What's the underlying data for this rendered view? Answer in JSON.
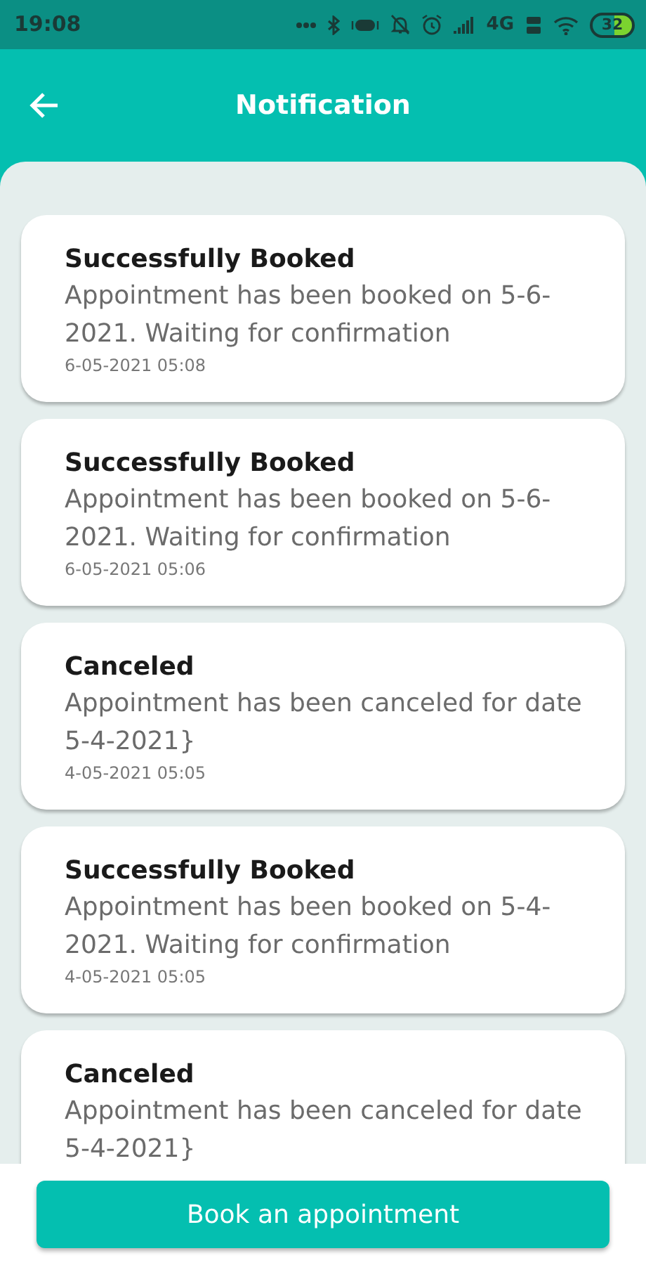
{
  "status_bar": {
    "time": "19:08",
    "network": "4G",
    "battery": "32"
  },
  "header": {
    "title": "Notification"
  },
  "notifications": [
    {
      "title": "Successfully Booked",
      "message": "Appointment has been booked on 5-6-2021. Waiting for confirmation",
      "time": "6-05-2021 05:08"
    },
    {
      "title": "Successfully Booked",
      "message": "Appointment has been booked on 5-6-2021. Waiting for confirmation",
      "time": "6-05-2021 05:06"
    },
    {
      "title": "Canceled",
      "message": "Appointment has been canceled for date 5-4-2021}",
      "time": "4-05-2021 05:05"
    },
    {
      "title": "Successfully Booked",
      "message": "Appointment has been booked on 5-4-2021. Waiting for confirmation",
      "time": "4-05-2021 05:05"
    },
    {
      "title": "Canceled",
      "message": "Appointment has been canceled for date 5-4-2021}"
    }
  ],
  "button": "Book an appointment"
}
